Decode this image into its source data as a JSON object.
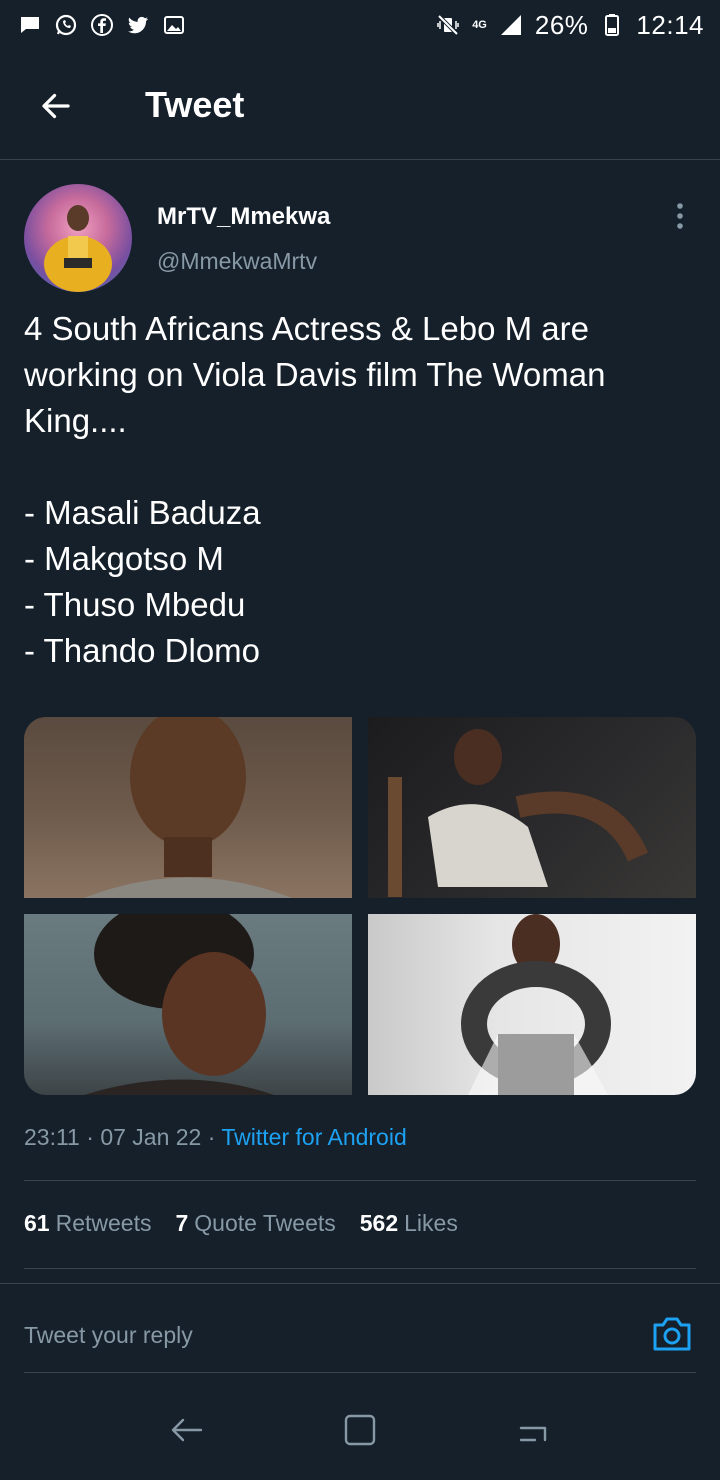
{
  "status_bar": {
    "time": "12:14",
    "battery": "26%",
    "network": "4G",
    "icons": [
      "message-icon",
      "whatsapp-icon",
      "facebook-icon",
      "twitter-icon",
      "gallery-icon"
    ]
  },
  "header": {
    "title": "Tweet"
  },
  "tweet": {
    "author_name": "MrTV_Mmekwa",
    "author_handle": "@MmekwaMrtv",
    "text": "4 South Africans Actress & Lebo M are working on Viola Davis film The Woman King....\n\n- Masali Baduza\n- Makgotso M\n- Thuso Mbedu\n- Thando Dlomo",
    "time": "23:11",
    "date": "07 Jan 22",
    "source": "Twitter for Android",
    "separator": "·"
  },
  "stats": {
    "retweets_count": "61",
    "retweets_label": "Retweets",
    "quote_count": "7",
    "quote_label": "Quote Tweets",
    "likes_count": "562",
    "likes_label": "Likes"
  },
  "reply": {
    "placeholder": "Tweet your reply"
  },
  "colors": {
    "background": "#15202b",
    "accent": "#1da1f2",
    "secondary_text": "#8899a6",
    "divider": "#38444d"
  }
}
